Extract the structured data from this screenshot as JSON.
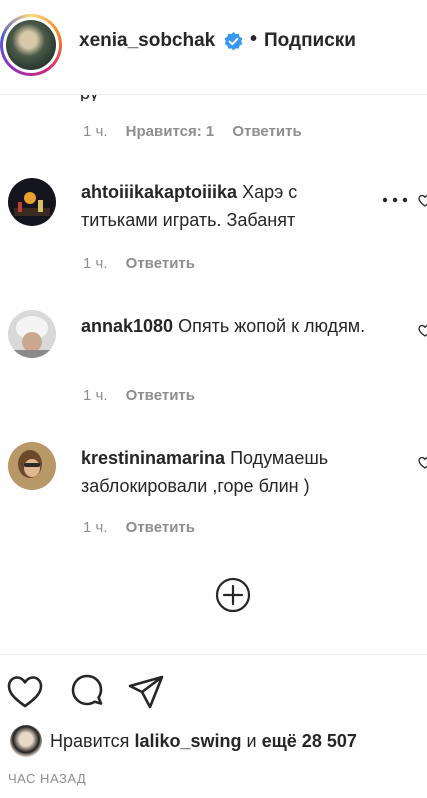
{
  "header": {
    "username": "xenia_sobchak",
    "separator": "•",
    "follow_label": "Подписки"
  },
  "partial_comment": {
    "text": "ру",
    "time": "1 ч.",
    "likes": "Нравится: 1",
    "reply": "Ответить"
  },
  "comments": [
    {
      "username": "ahtoiiikakaptoiiika",
      "text": "Харэ с титьками играть. Забанят",
      "time": "1 ч.",
      "reply": "Ответить"
    },
    {
      "username": "annak1080",
      "text": "Опять жопой к людям.",
      "time": "1 ч.",
      "reply": "Ответить"
    },
    {
      "username": "krestininamarina",
      "text": "Подумаешь заблокировали ,горе блин )",
      "time": "1 ч.",
      "reply": "Ответить"
    }
  ],
  "actions": {
    "like_icon": "heart-icon",
    "comment_icon": "comment-icon",
    "share_icon": "send-icon",
    "load_more_icon": "plus-circle-icon"
  },
  "likes": {
    "prefix": "Нравится",
    "user": "laliko_swing",
    "conj": "и",
    "more": "ещё 28 507"
  },
  "timestamp": "ЧАС НАЗАД",
  "colors": {
    "text": "#262626",
    "secondary": "#8e8e8e",
    "verified": "#3897f0",
    "divider": "#efefef"
  }
}
